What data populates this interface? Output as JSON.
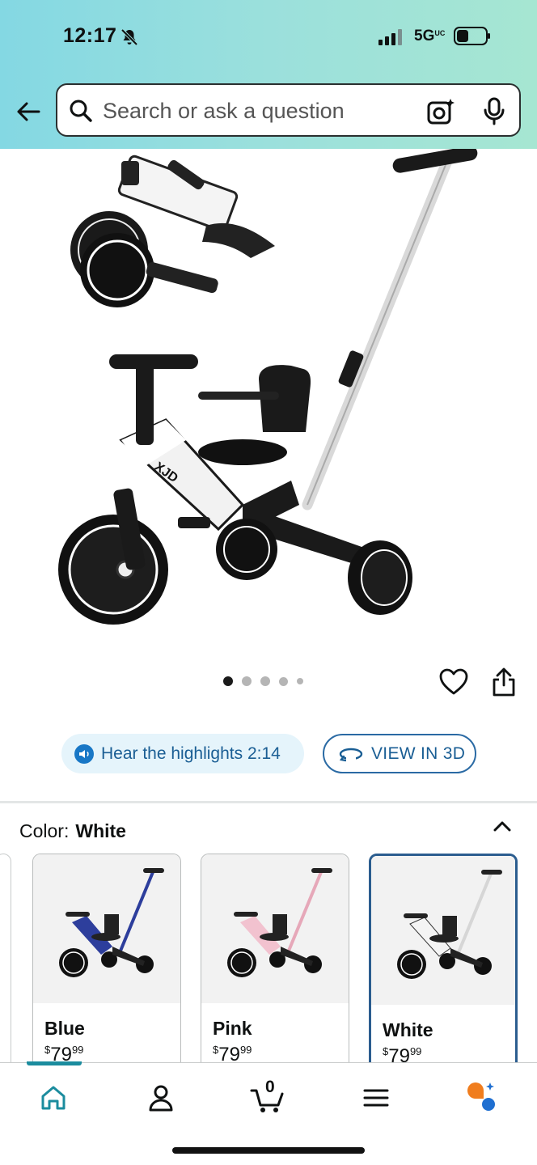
{
  "status_bar": {
    "time": "12:17",
    "network": "5G",
    "network_sup": "UC",
    "icons": [
      "bell-off-icon",
      "signal-icon",
      "battery-icon"
    ]
  },
  "search": {
    "placeholder": "Search or ask a question",
    "icons": [
      "back-arrow-icon",
      "search-icon",
      "camera-icon",
      "mic-icon"
    ]
  },
  "gallery": {
    "image_count": 5,
    "active_index": 0
  },
  "actions": {
    "hear_highlights": "Hear the highlights 2:14",
    "view_3d": "VIEW IN 3D"
  },
  "color_selector": {
    "label": "Color:",
    "selected": "White",
    "options": [
      {
        "name": "Blue",
        "price_symbol": "$",
        "price_whole": "79",
        "price_fraction": "99",
        "accent": "#2d3e9c"
      },
      {
        "name": "Pink",
        "price_symbol": "$",
        "price_whole": "79",
        "price_fraction": "99",
        "accent": "#e6a8b9"
      },
      {
        "name": "White",
        "price_symbol": "$",
        "price_whole": "79",
        "price_fraction": "99",
        "accent": "#e8e8e8"
      }
    ]
  },
  "bottom_nav": {
    "cart_count": "0",
    "items": [
      "home-icon",
      "account-icon",
      "cart-icon",
      "menu-icon",
      "rufus-icon"
    ],
    "active": "home-icon"
  },
  "colors": {
    "header_gradient_start": "#84d8e3",
    "header_gradient_end": "#a6e6d2",
    "link_blue": "#1a5e94",
    "selected_border": "#2b5d8f",
    "nav_active": "#1b8c9e"
  }
}
